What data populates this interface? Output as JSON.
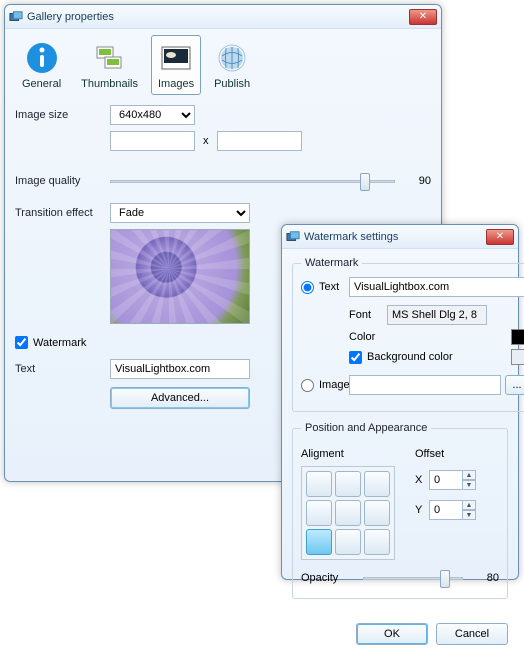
{
  "gallery": {
    "title": "Gallery properties",
    "tabs": {
      "general": "General",
      "thumbnails": "Thumbnails",
      "images": "Images",
      "publish": "Publish"
    },
    "labels": {
      "image_size": "Image size",
      "image_quality": "Image quality",
      "transition": "Transition effect",
      "watermark": "Watermark",
      "text": "Text",
      "advanced": "Advanced..."
    },
    "image_size_value": "640x480",
    "quality_value": "90",
    "transition_value": "Fade",
    "watermark_checked": true,
    "text_value": "VisualLightbox.com",
    "dim_sep": "x"
  },
  "wm": {
    "title": "Watermark settings",
    "group": "Watermark",
    "text_radio": "Text",
    "text_value": "VisualLightbox.com",
    "font_label": "Font",
    "font_value": "MS Shell Dlg 2, 8",
    "color_label": "Color",
    "bg_label": "Background color",
    "image_radio": "Image",
    "browse": "...",
    "pa_group": "Position and Appearance",
    "alignment": "Aligment",
    "offset": "Offset",
    "x_label": "X",
    "y_label": "Y",
    "x_value": "0",
    "y_value": "0",
    "opacity_label": "Opacity",
    "opacity_value": "80",
    "ok": "OK",
    "cancel": "Cancel"
  }
}
